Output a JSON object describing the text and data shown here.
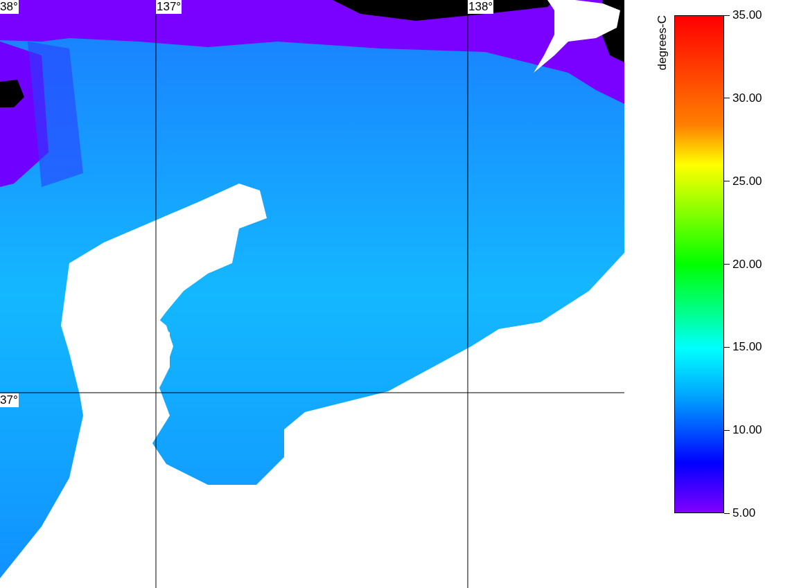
{
  "map": {
    "longitude_labels": [
      "137°",
      "138°"
    ],
    "latitude_labels": [
      "38°",
      "37°"
    ]
  },
  "colorbar": {
    "title": "degrees-C",
    "ticks": [
      "35.00",
      "30.00",
      "25.00",
      "20.00",
      "15.00",
      "10.00",
      "5.00"
    ]
  }
}
